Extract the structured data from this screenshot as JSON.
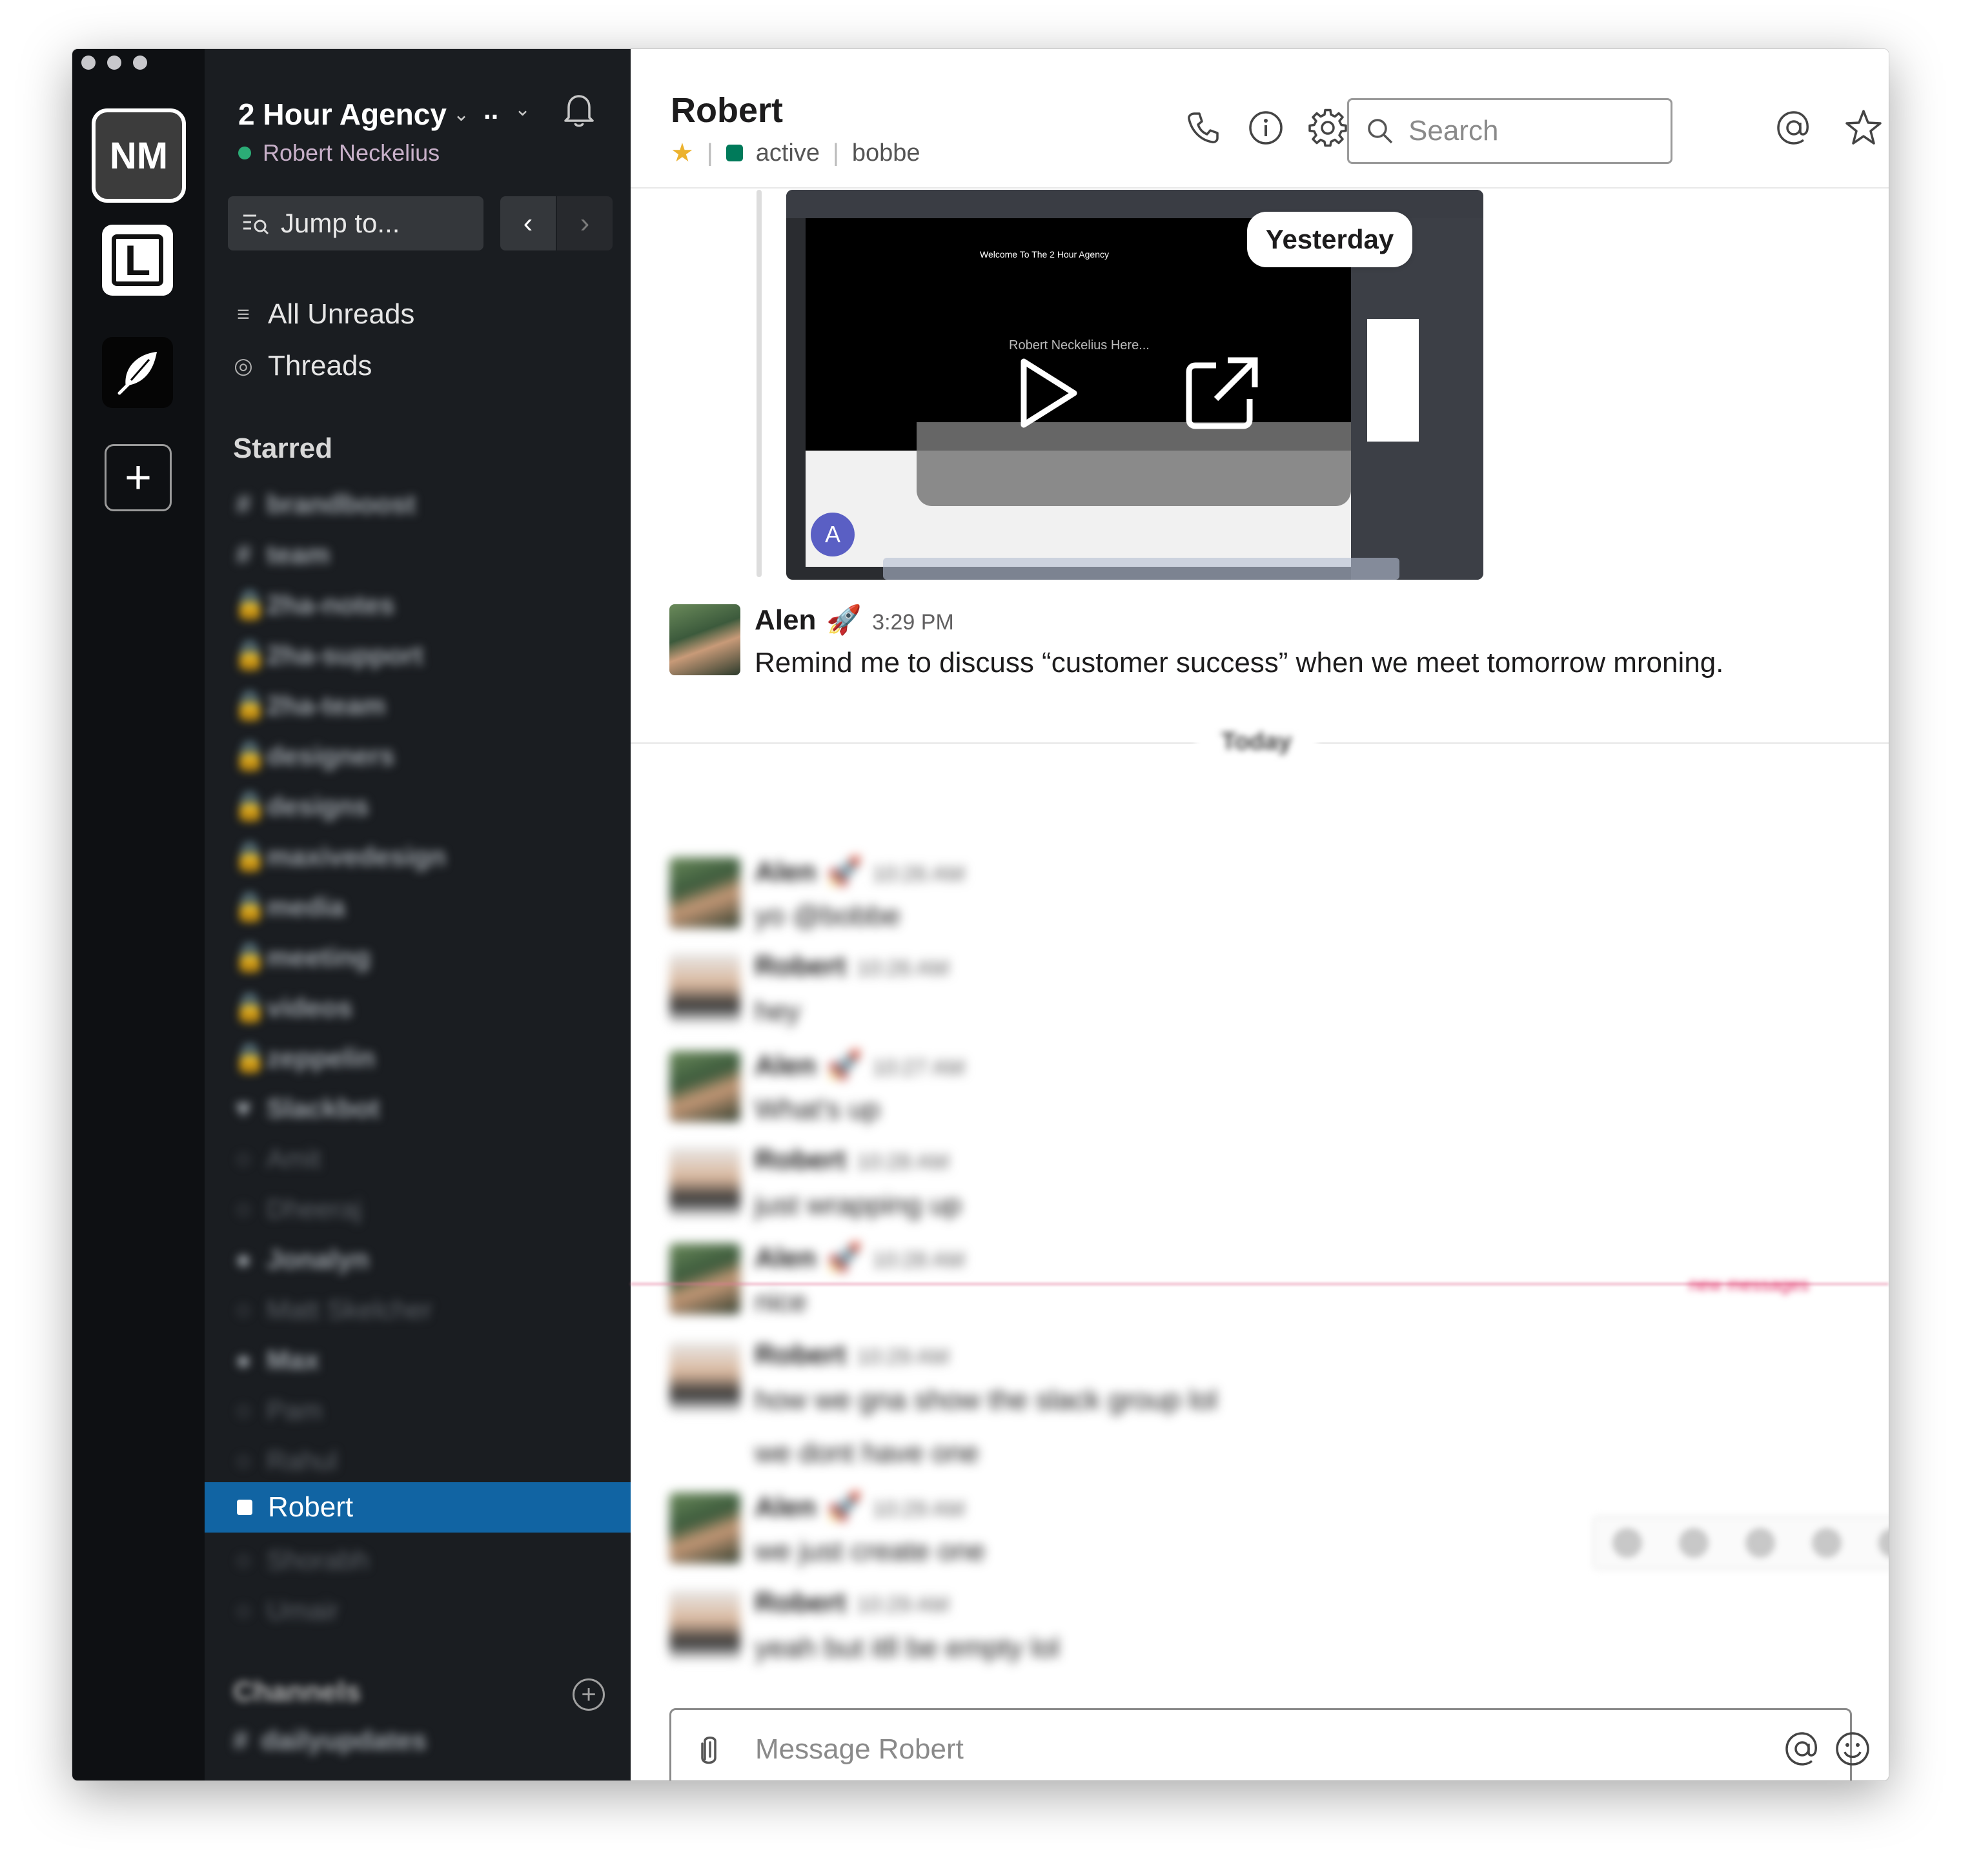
{
  "workspace_bar": {
    "workspaces": [
      {
        "initials": "NM",
        "active": true
      },
      {
        "initials": "L"
      },
      {
        "initials": ""
      }
    ],
    "add_label": "+"
  },
  "sidebar": {
    "team_name": "2 Hour Agency",
    "team_dots": "..",
    "user_name": "Robert Neckelius",
    "jump_to": "Jump to...",
    "nav_back": "‹",
    "nav_forward": "›",
    "all_unreads": "All Unreads",
    "threads": "Threads",
    "starred_title": "Starred",
    "starred_items": [
      {
        "prefix": "#",
        "name": "brandboost"
      },
      {
        "prefix": "#",
        "name": "team"
      },
      {
        "prefix": "🔒",
        "name": "2ha-notes"
      },
      {
        "prefix": "🔒",
        "name": "2ha-support"
      },
      {
        "prefix": "🔒",
        "name": "2ha-team"
      },
      {
        "prefix": "🔒",
        "name": "designers"
      },
      {
        "prefix": "🔒",
        "name": "designs"
      },
      {
        "prefix": "🔒",
        "name": "maxivedesign"
      },
      {
        "prefix": "🔒",
        "name": "media"
      },
      {
        "prefix": "🔒",
        "name": "meeting"
      },
      {
        "prefix": "🔒",
        "name": "videos"
      },
      {
        "prefix": "🔒",
        "name": "zeppelin"
      },
      {
        "prefix": "♥",
        "name": "Slackbot"
      },
      {
        "prefix": "○",
        "name": "Amit",
        "dim": true
      },
      {
        "prefix": "○",
        "name": "Dheeraj",
        "dim": true
      },
      {
        "prefix": "●",
        "name": "Jonalyn"
      },
      {
        "prefix": "○",
        "name": "Matt Skelcher",
        "dim": true
      },
      {
        "prefix": "●",
        "name": "Max"
      },
      {
        "prefix": "○",
        "name": "Pam",
        "dim": true
      },
      {
        "prefix": "○",
        "name": "Rahul",
        "dim": true
      }
    ],
    "active_item": "Robert",
    "after_active": [
      {
        "prefix": "○",
        "name": "Shorabh",
        "dim": true
      },
      {
        "prefix": "○",
        "name": "Umair",
        "dim": true
      }
    ],
    "channels_title": "Channels",
    "channels_first": "dailyupdates"
  },
  "header": {
    "title": "Robert",
    "status": "active",
    "handle": "bobbe",
    "search_placeholder": "Search"
  },
  "messages": {
    "day_yesterday": "Yesterday",
    "video": {
      "inner_title": "Welcome To The 2 Hour Agency",
      "inner_subtitle": "Robert Neckelius Here...",
      "avatar_letter": "A"
    },
    "alen_message": {
      "author": "Alen",
      "emoji": "🚀",
      "time": "3:29 PM",
      "text": "Remind me to discuss “customer success” when we meet tomorrow mroning."
    },
    "day_today": "Today",
    "today_messages": [
      {
        "author": "Alen",
        "emoji": "🚀",
        "time": "10:26 AM",
        "lines": [
          "yo  @bobbe"
        ]
      },
      {
        "author": "Robert",
        "time": "10:26 AM",
        "lines": [
          "hey"
        ]
      },
      {
        "author": "Alen",
        "emoji": "🚀",
        "time": "10:27 AM",
        "lines": [
          "What's up"
        ]
      },
      {
        "author": "Robert",
        "time": "10:28 AM",
        "lines": [
          "just wrapping up"
        ]
      },
      {
        "author": "Alen",
        "emoji": "🚀",
        "time": "10:28 AM",
        "lines": [
          "nice"
        ]
      },
      {
        "author": "Robert",
        "time": "10:29 AM",
        "lines": [
          "how we gna show the slack group lol",
          "we dont have one"
        ]
      },
      {
        "author": "Alen",
        "emoji": "🚀",
        "time": "10:29 AM",
        "lines": [
          "we just create one"
        ]
      },
      {
        "author": "Robert",
        "time": "10:29 AM",
        "lines": [
          "yeah but itll be empty lol"
        ]
      }
    ],
    "new_messages_label": "new messages"
  },
  "composer": {
    "placeholder": "Message Robert"
  },
  "colors": {
    "sidebar_bg": "#1a1d21",
    "workspace_bg": "#0e1013",
    "active_item": "#1164a3",
    "presence_active": "#2bac76",
    "star": "#ecb22e",
    "new_messages": "#e01e5a"
  }
}
